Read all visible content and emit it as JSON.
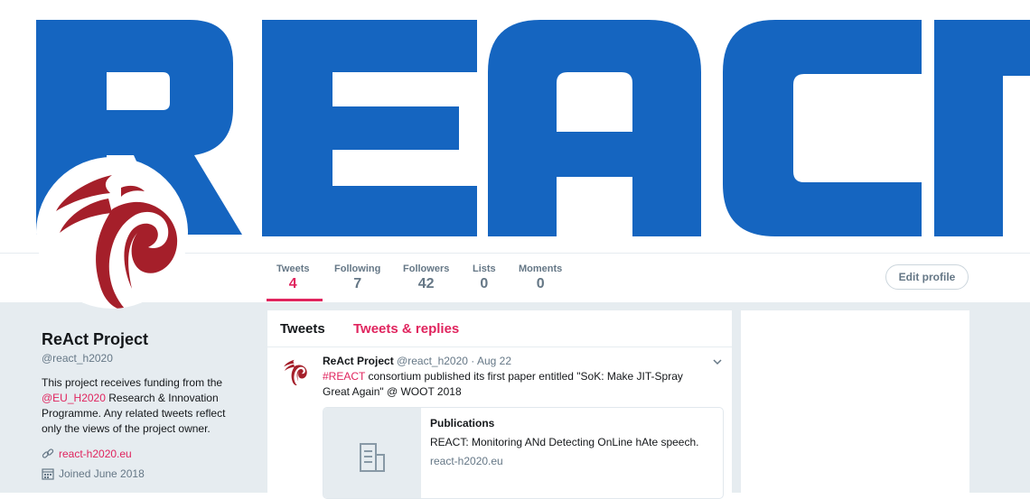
{
  "banner": {
    "brand_text": "REACT",
    "color": "#1565c0"
  },
  "profile": {
    "name": "ReAct Project",
    "handle": "@react_h2020",
    "bio_part1": "This project receives funding from the ",
    "bio_mention": "@EU_H2020",
    "bio_part2": " Research & Innovation Programme. Any related tweets reflect only the views of the project owner.",
    "website": "react-h2020.eu",
    "joined": "Joined June 2018",
    "logo_icon": "phoenix-logo-icon"
  },
  "nav": {
    "stats": [
      {
        "label": "Tweets",
        "value": "4"
      },
      {
        "label": "Following",
        "value": "7"
      },
      {
        "label": "Followers",
        "value": "42"
      },
      {
        "label": "Lists",
        "value": "0"
      },
      {
        "label": "Moments",
        "value": "0"
      }
    ],
    "edit_profile": "Edit profile"
  },
  "timeline": {
    "tabs": [
      "Tweets",
      "Tweets & replies"
    ],
    "tweets": [
      {
        "author": "ReAct Project",
        "handle": "@react_h2020",
        "date": "· Aug 22",
        "hashtag": "#REACT",
        "text": " consortium published its first paper entitled \"SoK: Make JIT-Spray Great Again\" @ WOOT 2018",
        "card": {
          "title": "Publications",
          "description": "REACT: Monitoring ANd Detecting OnLine hAte speech.",
          "domain": "react-h2020.eu"
        }
      }
    ]
  },
  "colors": {
    "accent": "#e0245e",
    "secondary_text": "#657786",
    "logo_red": "#a51f2a"
  }
}
